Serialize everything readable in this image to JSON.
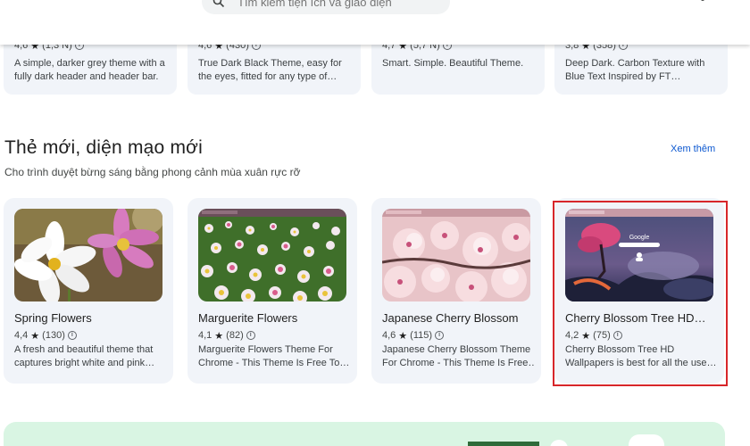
{
  "search": {
    "placeholder": "Tìm kiếm tiện ích và giao diện"
  },
  "top_cards": [
    {
      "rating": "4,6",
      "count": "(1,3 N)",
      "desc1": "A simple, darker grey theme with a",
      "desc2": "fully dark header and header bar."
    },
    {
      "rating": "4,6",
      "count": "(430)",
      "desc1": "True Dark Black Theme, easy for",
      "desc2": "the eyes, fitted for any type of…"
    },
    {
      "rating": "4,7",
      "count": "(5,7 N)",
      "desc1": "Smart. Simple. Beautiful Theme.",
      "desc2": ""
    },
    {
      "rating": "3,8",
      "count": "(358)",
      "desc1": "Deep Dark. Carbon Texture with",
      "desc2": "Blue Text Inspired by FT…"
    }
  ],
  "section": {
    "title": "Thẻ mới, diện mạo mới",
    "subtitle": "Cho trình duyệt bừng sáng bằng phong cảnh mùa xuân rực rỡ",
    "see_more": "Xem thêm"
  },
  "themes": [
    {
      "name": "Spring Flowers",
      "rating": "4,4",
      "count": "(130)",
      "desc1": "A fresh and beautiful theme that",
      "desc2": "captures bright white and pink…"
    },
    {
      "name": "Marguerite Flowers",
      "rating": "4,1",
      "count": "(82)",
      "desc1": "Marguerite Flowers Theme For",
      "desc2": "Chrome - This Theme Is Free To…"
    },
    {
      "name": "Japanese Cherry Blossom",
      "rating": "4,6",
      "count": "(115)",
      "desc1": "Japanese Cherry Blossom Theme",
      "desc2": "For Chrome - This Theme Is Free…"
    },
    {
      "name": "Cherry Blossom Tree HD…",
      "rating": "4,2",
      "count": "(75)",
      "desc1": "Cherry Blossom Tree HD",
      "desc2": "Wallpapers is best for all the use…",
      "thumb_logo": "Google"
    }
  ],
  "colors": {
    "card_bg": "#f1f4f9",
    "link": "#0b57d0",
    "highlight": "#d7262a",
    "banner": "#d9f5e3"
  }
}
